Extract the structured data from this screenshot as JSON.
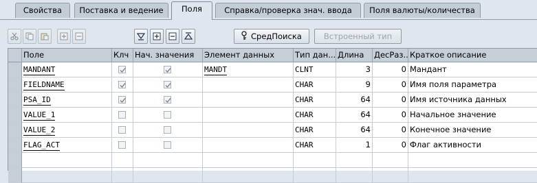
{
  "tabs": [
    {
      "label": "Свойства",
      "active": false
    },
    {
      "label": "Поставка и ведение",
      "active": false
    },
    {
      "label": "Поля",
      "active": true
    },
    {
      "label": "Справка/проверка знач. ввода",
      "active": false
    },
    {
      "label": "Поля валюты/количества",
      "active": false
    }
  ],
  "toolbar": {
    "search_help_label": "СредПоиска",
    "builtin_type_label": "Встроенный тип"
  },
  "table": {
    "columns": [
      "Поле",
      "Клч",
      "Нач. значения",
      "Элемент данных",
      "Тип дан...",
      "Длина",
      "ДесРаз...",
      "Краткое описание"
    ],
    "rows": [
      {
        "field": "MANDANT",
        "key": true,
        "initial": true,
        "data_element": "MANDT",
        "type": "CLNT",
        "length": "3",
        "decimals": "0",
        "description": "Мандант"
      },
      {
        "field": "FIELDNAME",
        "key": true,
        "initial": true,
        "data_element": "",
        "type": "CHAR",
        "length": "9",
        "decimals": "0",
        "description": "Имя поля параметра"
      },
      {
        "field": "PSA_ID",
        "key": true,
        "initial": true,
        "data_element": "",
        "type": "CHAR",
        "length": "64",
        "decimals": "0",
        "description": "Имя источника данных"
      },
      {
        "field": "VALUE_1",
        "key": false,
        "initial": false,
        "data_element": "",
        "type": "CHAR",
        "length": "64",
        "decimals": "0",
        "description": "Начальное значение"
      },
      {
        "field": "VALUE_2",
        "key": false,
        "initial": false,
        "data_element": "",
        "type": "CHAR",
        "length": "64",
        "decimals": "0",
        "description": "Конечное значение"
      },
      {
        "field": "FLAG_ACT",
        "key": false,
        "initial": false,
        "data_element": "",
        "type": "CHAR",
        "length": "1",
        "decimals": "0",
        "description": "Флаг активности"
      }
    ]
  },
  "colors": {
    "background": "#dfe6ed",
    "header": "#c6cfd7",
    "grid_line": "#c5ccd3",
    "border": "#8e9aa6"
  }
}
